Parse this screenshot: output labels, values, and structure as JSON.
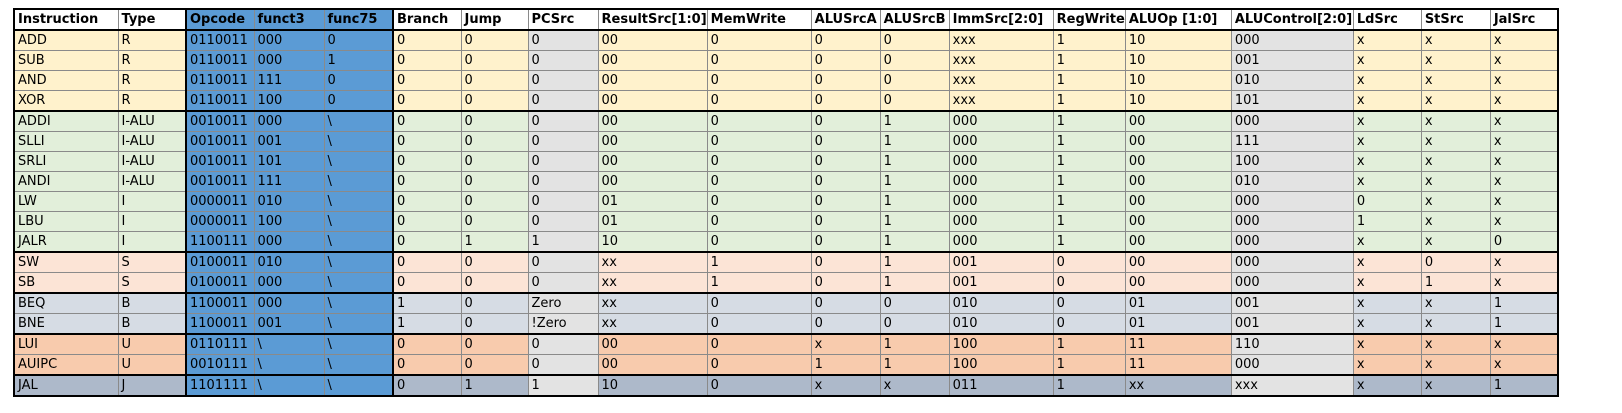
{
  "table": {
    "headers": [
      "Instruction",
      "Type",
      "Opcode",
      "funct3",
      "func75",
      "Branch",
      "Jump",
      "PCSrc",
      "ResultSrc[1:0]",
      "MemWrite",
      "ALUSrcA",
      "ALUSrcB",
      "ImmSrc[2:0]",
      "RegWrite",
      "ALUOp [1:0]",
      "ALUControl[2:0]",
      "LdSrc",
      "StSrc",
      "JalSrc"
    ],
    "rows": [
      {
        "group": "R",
        "cells": [
          "ADD",
          "R",
          "0110011",
          "000",
          "0",
          "0",
          "0",
          "0",
          "00",
          "0",
          "0",
          "0",
          "xxx",
          "1",
          "10",
          "000",
          "x",
          "x",
          "x"
        ]
      },
      {
        "group": "R",
        "cells": [
          "SUB",
          "R",
          "0110011",
          "000",
          "1",
          "0",
          "0",
          "0",
          "00",
          "0",
          "0",
          "0",
          "xxx",
          "1",
          "10",
          "001",
          "x",
          "x",
          "x"
        ]
      },
      {
        "group": "R",
        "cells": [
          "AND",
          "R",
          "0110011",
          "111",
          "0",
          "0",
          "0",
          "0",
          "00",
          "0",
          "0",
          "0",
          "xxx",
          "1",
          "10",
          "010",
          "x",
          "x",
          "x"
        ]
      },
      {
        "group": "R",
        "cells": [
          "XOR",
          "R",
          "0110011",
          "100",
          "0",
          "0",
          "0",
          "0",
          "00",
          "0",
          "0",
          "0",
          "xxx",
          "1",
          "10",
          "101",
          "x",
          "x",
          "x"
        ]
      },
      {
        "group": "IALU",
        "cells": [
          "ADDI",
          "I-ALU",
          "0010011",
          "000",
          "\\",
          "0",
          "0",
          "0",
          "00",
          "0",
          "0",
          "1",
          "000",
          "1",
          "00",
          "000",
          "x",
          "x",
          "x"
        ]
      },
      {
        "group": "IALU",
        "cells": [
          "SLLI",
          "I-ALU",
          "0010011",
          "001",
          "\\",
          "0",
          "0",
          "0",
          "00",
          "0",
          "0",
          "1",
          "000",
          "1",
          "00",
          "111",
          "x",
          "x",
          "x"
        ]
      },
      {
        "group": "IALU",
        "cells": [
          "SRLI",
          "I-ALU",
          "0010011",
          "101",
          "\\",
          "0",
          "0",
          "0",
          "00",
          "0",
          "0",
          "1",
          "000",
          "1",
          "00",
          "100",
          "x",
          "x",
          "x"
        ]
      },
      {
        "group": "IALU",
        "cells": [
          "ANDI",
          "I-ALU",
          "0010011",
          "111",
          "\\",
          "0",
          "0",
          "0",
          "00",
          "0",
          "0",
          "1",
          "000",
          "1",
          "00",
          "010",
          "x",
          "x",
          "x"
        ]
      },
      {
        "group": "I",
        "cells": [
          "LW",
          "I",
          "0000011",
          "010",
          "\\",
          "0",
          "0",
          "0",
          "01",
          "0",
          "0",
          "1",
          "000",
          "1",
          "00",
          "000",
          "0",
          "x",
          "x"
        ]
      },
      {
        "group": "I",
        "cells": [
          "LBU",
          "I",
          "0000011",
          "100",
          "\\",
          "0",
          "0",
          "0",
          "01",
          "0",
          "0",
          "1",
          "000",
          "1",
          "00",
          "000",
          "1",
          "x",
          "x"
        ]
      },
      {
        "group": "I",
        "cells": [
          "JALR",
          "I",
          "1100111",
          "000",
          "\\",
          "0",
          "1",
          "1",
          "10",
          "0",
          "0",
          "1",
          "000",
          "1",
          "00",
          "000",
          "x",
          "x",
          "0"
        ]
      },
      {
        "group": "S",
        "cells": [
          "SW",
          "S",
          "0100011",
          "010",
          "\\",
          "0",
          "0",
          "0",
          "xx",
          "1",
          "0",
          "1",
          "001",
          "0",
          "00",
          "000",
          "x",
          "0",
          "x"
        ]
      },
      {
        "group": "S",
        "cells": [
          "SB",
          "S",
          "0100011",
          "000",
          "\\",
          "0",
          "0",
          "0",
          "xx",
          "1",
          "0",
          "1",
          "001",
          "0",
          "00",
          "000",
          "x",
          "1",
          "x"
        ]
      },
      {
        "group": "B",
        "cells": [
          "BEQ",
          "B",
          "1100011",
          "000",
          "\\",
          "1",
          "0",
          "Zero",
          "xx",
          "0",
          "0",
          "0",
          "010",
          "0",
          "01",
          "001",
          "x",
          "x",
          "1"
        ]
      },
      {
        "group": "B",
        "cells": [
          "BNE",
          "B",
          "1100011",
          "001",
          "\\",
          "1",
          "0",
          "!Zero",
          "xx",
          "0",
          "0",
          "0",
          "010",
          "0",
          "01",
          "001",
          "x",
          "x",
          "1"
        ]
      },
      {
        "group": "U",
        "cells": [
          "LUI",
          "U",
          "0110111",
          "\\",
          "\\",
          "0",
          "0",
          "0",
          "00",
          "0",
          "x",
          "1",
          "100",
          "1",
          "11",
          "110",
          "x",
          "x",
          "x"
        ]
      },
      {
        "group": "U",
        "cells": [
          "AUIPC",
          "U",
          "0010111",
          "\\",
          "\\",
          "0",
          "0",
          "0",
          "00",
          "0",
          "1",
          "1",
          "100",
          "1",
          "11",
          "000",
          "x",
          "x",
          "x"
        ]
      },
      {
        "group": "J",
        "cells": [
          "JAL",
          "J",
          "1101111",
          "\\",
          "\\",
          "0",
          "1",
          "1",
          "10",
          "0",
          "x",
          "x",
          "011",
          "1",
          "xx",
          "xxx",
          "x",
          "x",
          "1"
        ]
      }
    ]
  },
  "colors": {
    "R": "#fff2cc",
    "I-ALU": "#e2efda",
    "I": "#e2efda",
    "S": "#fce4d6",
    "B": "#d6dce4",
    "U": "#f8cbad",
    "J": "#adb9ca",
    "opcode_columns": "#5b9bd5",
    "gray_columns": "#e3e3e3"
  }
}
